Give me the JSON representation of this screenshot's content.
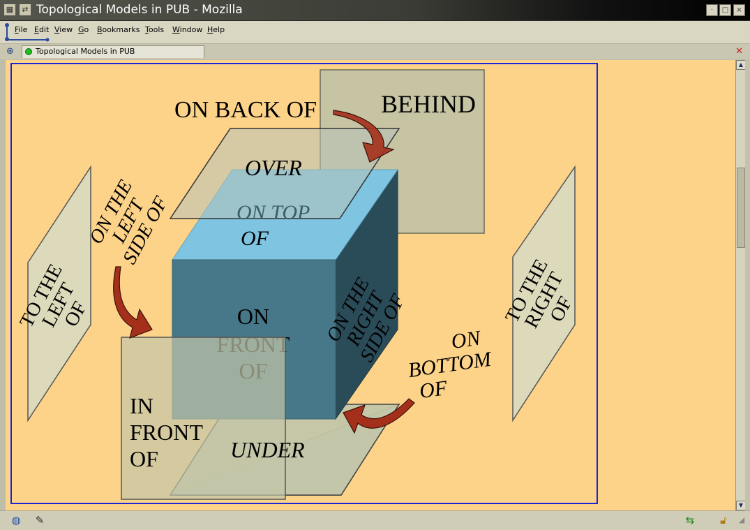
{
  "window": {
    "title": "Topological Models in PUB - Mozilla",
    "buttons": {
      "minimize": "·",
      "maximize": "□",
      "close": "×"
    }
  },
  "menu": {
    "items": [
      "File",
      "Edit",
      "View",
      "Go",
      "Bookmarks",
      "Tools",
      "Window",
      "Help"
    ]
  },
  "tabs": [
    {
      "label": "Topological Models in PUB",
      "status": "loaded"
    }
  ],
  "diagram": {
    "labels": {
      "on_back_of": "ON BACK OF",
      "behind": "BEHIND",
      "over": "OVER",
      "on_top_of_1": "ON TOP",
      "on_top_of_2": "OF",
      "on_left_side_1": "ON THE",
      "on_left_side_2": "LEFT",
      "on_left_side_3": "SIDE OF",
      "to_left_1": "TO THE",
      "to_left_2": "LEFT",
      "to_left_3": "OF",
      "on_front_1": "ON",
      "on_front_2": "FRONT",
      "on_front_3": "OF",
      "on_right_side_1": "ON THE",
      "on_right_side_2": "RIGHT",
      "on_right_side_3": "SIDE OF",
      "to_right_1": "TO THE",
      "to_right_2": "RIGHT",
      "to_right_3": "OF",
      "on_bottom_1": "ON",
      "on_bottom_2": "BOTTOM",
      "on_bottom_3": "OF",
      "in_front_1": "IN",
      "in_front_2": "FRONT",
      "in_front_3": "OF",
      "under": "UNDER"
    },
    "colors": {
      "background": "#fdd38a",
      "frame": "#1a25d8",
      "cube_top": "#7fc4e0",
      "cube_front": "#467889",
      "cube_side": "#2a4b58",
      "panel": "#c8c8b0",
      "arrow": "#a4301c"
    }
  }
}
